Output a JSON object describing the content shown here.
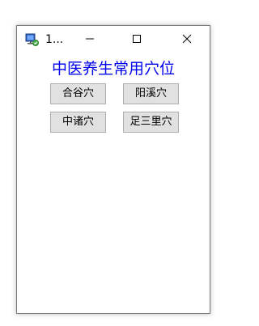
{
  "window": {
    "title": "1...",
    "app_title": "中医养生常用穴位",
    "icons": {
      "app": "program-icon",
      "minimize": "minimize-icon",
      "maximize": "maximize-icon",
      "close": "close-icon"
    }
  },
  "buttons": [
    {
      "label": "合谷穴"
    },
    {
      "label": "阳溪穴"
    },
    {
      "label": "中诸穴"
    },
    {
      "label": "足三里穴"
    }
  ],
  "colors": {
    "app_title": "#0000ee",
    "button_bg": "#e1e1e1",
    "button_border": "#adadad",
    "window_border": "#7a7a7a"
  }
}
